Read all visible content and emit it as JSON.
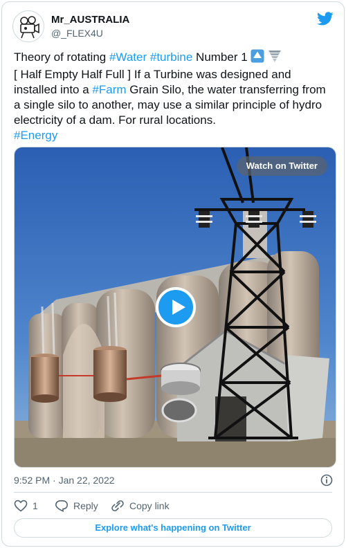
{
  "user": {
    "display_name": "Mr_AUSTRALIA",
    "handle": "@_FLEX4U",
    "avatar_icon": "camera-avatar-icon"
  },
  "tweet": {
    "line1_pre": "Theory of rotating ",
    "tag_water": "#Water",
    "space": " ",
    "tag_turbine": "#turbine",
    "line1_post": " Number 1 ",
    "line2": "[ Half Empty Half Full ] If a Turbine was designed and",
    "line3_pre": "installed into a ",
    "tag_farm": "#Farm",
    "line3_post": " Grain Silo, the water transferring from",
    "line4": "a single silo to another, may use a similar principle of hydro",
    "line5": "electricity of a dam. For rural locations.",
    "tag_energy": "#Energy",
    "emoji_icons": [
      "up-arrow-button-icon",
      "tornado-icon"
    ]
  },
  "media": {
    "watch_label": "Watch on Twitter",
    "play_icon": "play-icon"
  },
  "meta": {
    "timestamp": "9:52 PM · Jan 22, 2022"
  },
  "actions": {
    "like_count": "1",
    "reply_label": "Reply",
    "copy_label": "Copy link"
  },
  "footer": {
    "explore_label": "Explore what's happening on Twitter"
  },
  "colors": {
    "accent": "#1d9bf0",
    "text": "#0f1419",
    "muted": "#536471",
    "border": "#cfd9de"
  }
}
